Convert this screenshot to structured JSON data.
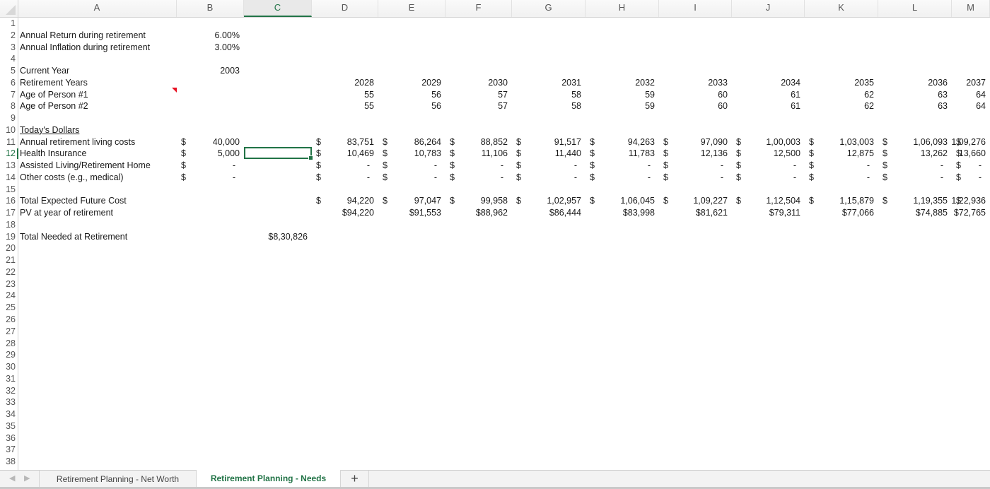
{
  "sheet": {
    "columns": [
      "A",
      "B",
      "C",
      "D",
      "E",
      "F",
      "G",
      "H",
      "I",
      "J",
      "K",
      "L",
      "M"
    ],
    "selected_column": "C",
    "selected_row": 12,
    "selected_cell": "C12",
    "row_count_visible": 38,
    "rows": {
      "r2": {
        "label": "Annual Return during retirement",
        "b": "6.00%"
      },
      "r3": {
        "label": "Annual Inflation during retirement",
        "b": "3.00%"
      },
      "r5": {
        "label": "Current Year",
        "b": "2003"
      },
      "r6": {
        "label": "Retirement Years",
        "values": [
          "2028",
          "2029",
          "2030",
          "2031",
          "2032",
          "2033",
          "2034",
          "2035",
          "2036",
          "2037"
        ]
      },
      "r7": {
        "label": "Age of Person #1",
        "values": [
          "55",
          "56",
          "57",
          "58",
          "59",
          "60",
          "61",
          "62",
          "63",
          "64"
        ]
      },
      "r8": {
        "label": "Age of Person #2",
        "values": [
          "55",
          "56",
          "57",
          "58",
          "59",
          "60",
          "61",
          "62",
          "63",
          "64"
        ]
      },
      "r10": {
        "label": "Today's Dollars"
      },
      "r11": {
        "label": "Annual retirement living costs",
        "b": "40,000",
        "values": [
          "83,751",
          "86,264",
          "88,852",
          "91,517",
          "94,263",
          "97,090",
          "1,00,003",
          "1,03,003",
          "1,06,093",
          "1,09,276"
        ]
      },
      "r12": {
        "label": "Health Insurance",
        "b": "5,000",
        "values": [
          "10,469",
          "10,783",
          "11,106",
          "11,440",
          "11,783",
          "12,136",
          "12,500",
          "12,875",
          "13,262",
          "13,660"
        ]
      },
      "r13": {
        "label": "Assisted Living/Retirement Home",
        "b": "-",
        "values": [
          "-",
          "-",
          "-",
          "-",
          "-",
          "-",
          "-",
          "-",
          "-",
          "-"
        ]
      },
      "r14": {
        "label": "Other costs (e.g., medical)",
        "b": "-",
        "values": [
          "-",
          "-",
          "-",
          "-",
          "-",
          "-",
          "-",
          "-",
          "-",
          "-"
        ]
      },
      "r16": {
        "label": "Total Expected Future Cost",
        "values": [
          "94,220",
          "97,047",
          "99,958",
          "1,02,957",
          "1,06,045",
          "1,09,227",
          "1,12,504",
          "1,15,879",
          "1,19,355",
          "1,22,936"
        ]
      },
      "r17": {
        "label": "PV at year of retirement",
        "values": [
          "$94,220",
          "$91,553",
          "$88,962",
          "$86,444",
          "$83,998",
          "$81,621",
          "$79,311",
          "$77,066",
          "$74,885",
          "$72,765"
        ]
      },
      "r19": {
        "label": "Total Needed at Retirement",
        "c": "$8,30,826"
      }
    },
    "currency_symbol": "$",
    "comment_indicator_cell": "A7"
  },
  "tabs": [
    {
      "label": "Retirement Planning - Net Worth",
      "active": false
    },
    {
      "label": "Retirement Planning - Needs",
      "active": true
    }
  ],
  "tabbar": {
    "add_label": "+",
    "prev_icon": "◀",
    "next_icon": "▶"
  },
  "colors": {
    "accent": "#217346",
    "comment": "#e81123"
  }
}
